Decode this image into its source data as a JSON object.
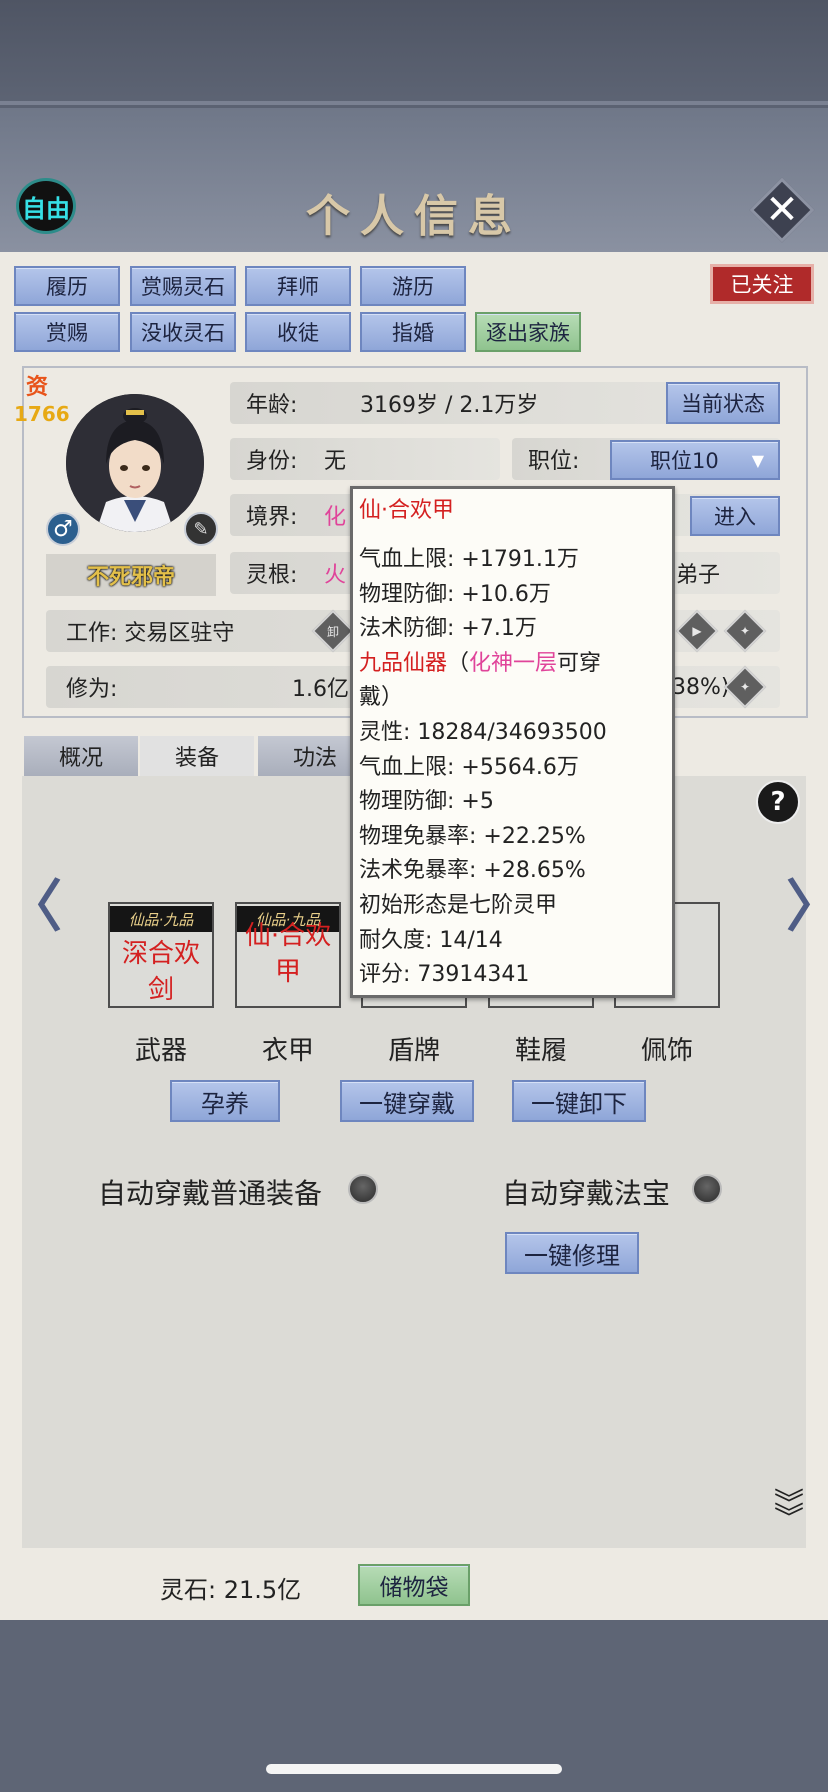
{
  "header": {
    "free_label": "自由",
    "title": "个人信息"
  },
  "actions": {
    "row1": [
      "履历",
      "赏赐灵石",
      "拜师",
      "游历"
    ],
    "row2": [
      "赏赐",
      "没收灵石",
      "收徒",
      "指婚",
      "逐出家族"
    ],
    "followed": "已关注"
  },
  "profile": {
    "aptitude_label": "资",
    "aptitude_value": "1766",
    "name": "不死邪帝",
    "male_symbol": "♂",
    "age_label": "年龄:",
    "age_value": "3169岁 / 2.1万岁",
    "current_state_btn": "当前状态",
    "identity_label": "身份:",
    "identity_value": "无",
    "position_label": "职位:",
    "position_value": "职位10",
    "realm_label": "境界:",
    "realm_value": "化",
    "enter_btn": "进入",
    "root_label": "灵根:",
    "root_value": "火",
    "disciple_text": "弟子",
    "work_label": "工作: 交易区驻守",
    "unload_label": "卸",
    "cultivation_label": "修为:",
    "cultivation_value": "1.6亿",
    "cultivation_pct": "38%)"
  },
  "tabs": [
    "概况",
    "装备",
    "功法"
  ],
  "equipment": {
    "slots": [
      {
        "label": "武器",
        "tag": "仙品·九品",
        "name_line1": "深合欢",
        "name_line2": "剑"
      },
      {
        "label": "衣甲",
        "tag": "仙品·九品",
        "name_line1": "仙·合欢",
        "name_line2": "甲"
      },
      {
        "label": "盾牌"
      },
      {
        "label": "鞋履"
      },
      {
        "label": "佩饰"
      }
    ],
    "nurture_btn": "孕养",
    "equip_all_btn": "一键穿戴",
    "unequip_all_btn": "一键卸下",
    "auto_normal_label": "自动穿戴普通装备",
    "auto_treasure_label": "自动穿戴法宝",
    "repair_btn": "一键修理"
  },
  "tooltip": {
    "title": "仙·合欢甲",
    "hp_max": "气血上限: +1791.1万",
    "phys_def": "物理防御: +10.6万",
    "magic_def": "法术防御: +7.1万",
    "grade": "九品仙器",
    "req_open": "（",
    "req_realm": "化神一层",
    "req_suffix": "可穿",
    "req_line2": "戴）",
    "spirit": "灵性: 18284/34693500",
    "hp_max2": "气血上限: +5564.6万",
    "phys_def2": "物理防御: +5",
    "phys_crit_res": "物理免暴率: +22.25%",
    "magic_crit_res": "法术免暴率: +28.65%",
    "initial_form": "初始形态是七阶灵甲",
    "durability": "耐久度: 14/14",
    "score": "评分: 73914341"
  },
  "footer": {
    "spirit_stone": "灵石: 21.5亿",
    "storage_btn": "储物袋"
  },
  "colors": {
    "accent_red": "#d42020",
    "pink": "#e0449a",
    "button_blue": "#9fb3e0",
    "button_green": "#9fcf9e"
  }
}
